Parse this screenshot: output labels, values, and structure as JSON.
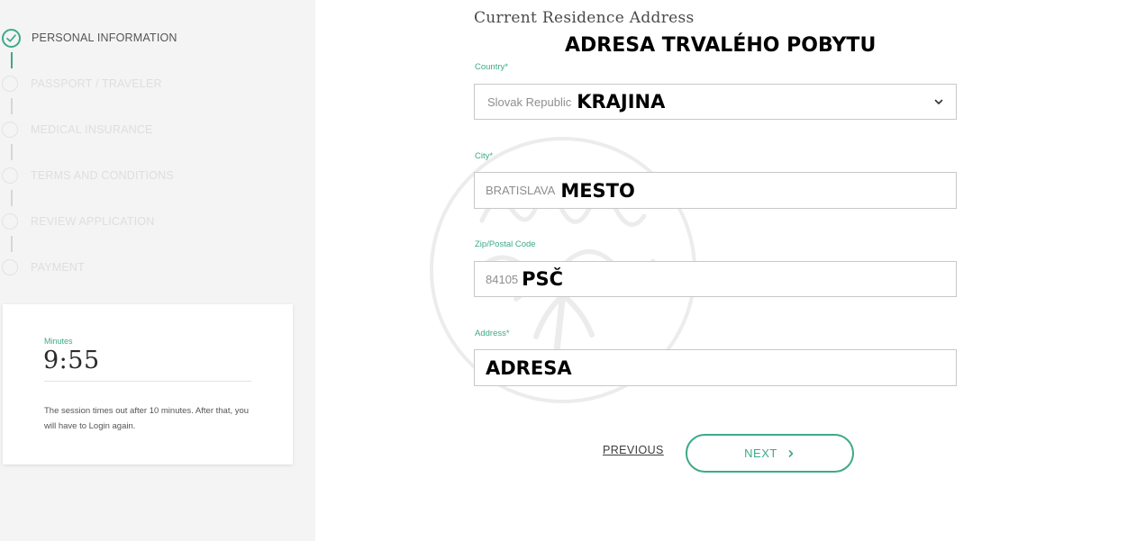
{
  "steps": [
    {
      "label": "PERSONAL INFORMATION",
      "status": "completed"
    },
    {
      "label": "PASSPORT / TRAVELER",
      "status": "pending"
    },
    {
      "label": "MEDICAL INSURANCE",
      "status": "pending"
    },
    {
      "label": "TERMS AND CONDITIONS",
      "status": "pending"
    },
    {
      "label": "REVIEW APPLICATION",
      "status": "pending"
    },
    {
      "label": "PAYMENT",
      "status": "pending"
    }
  ],
  "timer": {
    "label": "Minutes",
    "value": "9:55",
    "note": "The session times out after 10 minutes. After that, you will have to Login again."
  },
  "form": {
    "section_title": "Current Residence Address",
    "section_overlay": "ADRESA TRVALÉHO POBYTU",
    "country": {
      "label": "Country*",
      "value": "Slovak Republic",
      "overlay": "KRAJINA"
    },
    "city": {
      "label": "City*",
      "value": "BRATISLAVA",
      "overlay": "MESTO"
    },
    "zip": {
      "label": "Zip/Postal Code",
      "value": "84105",
      "overlay": "PSČ"
    },
    "address": {
      "label": "Address*",
      "value": "",
      "overlay": "ADRESA"
    }
  },
  "nav": {
    "previous_label": "PREVIOUS",
    "next_label": "NEXT"
  },
  "icons": {
    "check": "check-icon",
    "chevron_down": "chevron-down-icon",
    "chevron_right": "chevron-right-icon"
  },
  "colors": {
    "accent": "#3ea98a",
    "sidebar_bg": "#f4f4f4",
    "border": "#c8c8c8"
  }
}
